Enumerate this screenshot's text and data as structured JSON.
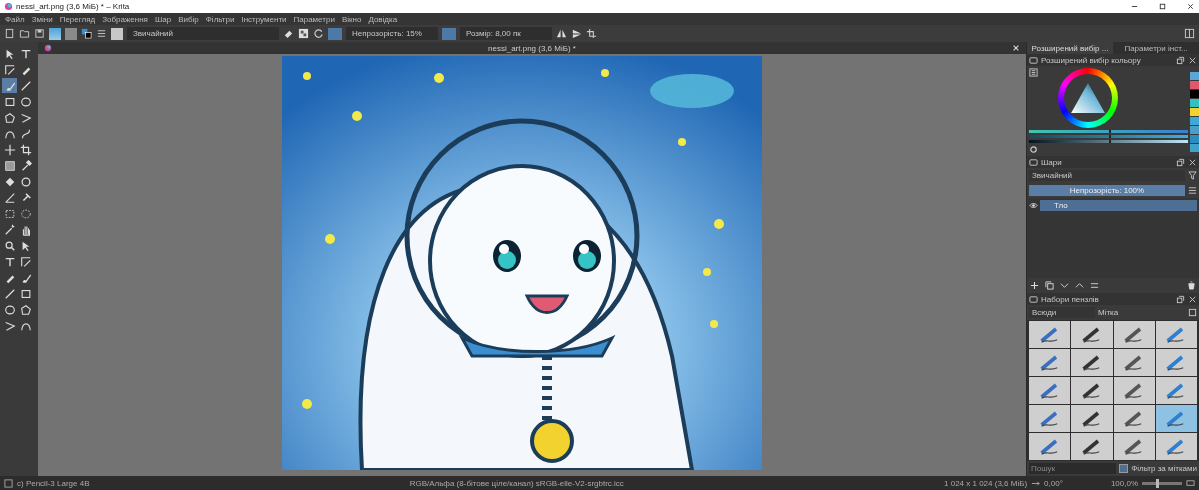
{
  "window": {
    "title": "nessi_art.png (3,6 МіБ) * – Krita"
  },
  "menu": [
    "Файл",
    "Зміни",
    "Перегляд",
    "Зображення",
    "Шар",
    "Вибір",
    "Фільтри",
    "Інструменти",
    "Параметри",
    "Вікно",
    "Довідка"
  ],
  "toolbar": {
    "blend_mode": "Звичайний",
    "opacity": "Непрозорість: 15%",
    "size": "Розмір: 8,00 пк"
  },
  "tools": [
    {
      "selected": false
    },
    {
      "selected": false
    },
    {
      "selected": false
    },
    {
      "selected": false
    },
    {
      "selected": true
    },
    {
      "selected": false
    },
    {
      "selected": false
    },
    {
      "selected": false
    },
    {
      "selected": false
    },
    {
      "selected": false
    },
    {
      "selected": false
    },
    {
      "selected": false
    },
    {
      "selected": false
    },
    {
      "selected": false
    },
    {
      "selected": false
    },
    {
      "selected": false
    },
    {
      "selected": false
    },
    {
      "selected": false
    },
    {
      "selected": false
    },
    {
      "selected": false
    },
    {
      "selected": false
    },
    {
      "selected": false
    },
    {
      "selected": false
    },
    {
      "selected": false
    },
    {
      "selected": false
    },
    {
      "selected": false
    },
    {
      "selected": false
    },
    {
      "selected": false
    },
    {
      "selected": false
    },
    {
      "selected": false
    },
    {
      "selected": false
    },
    {
      "selected": false
    },
    {
      "selected": false
    },
    {
      "selected": false
    },
    {
      "selected": false
    },
    {
      "selected": false
    }
  ],
  "document_tab": {
    "title": "nessi_art.png (3,6 МіБ) *"
  },
  "dock_tabs": [
    {
      "label": "Розширений вибір ...",
      "selected": true
    },
    {
      "label": "Параметри інст...",
      "selected": false
    }
  ],
  "color_selector": {
    "title": "Розширений вибір кольору",
    "sliders": [
      {
        "level": 0.5
      },
      {
        "level": 0.5
      },
      {
        "level": 0.5
      }
    ],
    "swatches": [
      {
        "color": "#5aa6d6"
      },
      {
        "color": "#e0596b"
      },
      {
        "color": "#000000"
      },
      {
        "color": "#2fc2c0"
      },
      {
        "color": "#f3d130"
      },
      {
        "color": "#3ea9d9"
      },
      {
        "color": "#4d9ec7"
      },
      {
        "color": "#2b8cbf"
      },
      {
        "color": "#3fa2cb"
      }
    ]
  },
  "layers": {
    "title": "Шари",
    "blend_mode": "Звичайний",
    "opacity": {
      "label": "Непрозорість: 100%",
      "level": 1
    },
    "items": [
      {
        "name": "Тло",
        "visible": true,
        "selected": true
      }
    ]
  },
  "brush_presets": {
    "title": "Набори пензлів",
    "filter": "Всюди",
    "tag": "Мітка",
    "search": {
      "placeholder": "Пошук"
    },
    "filter_by_tag": {
      "label": "Фільтр за мітками",
      "checked": true
    },
    "items": [
      {
        "selected": false
      },
      {
        "selected": false
      },
      {
        "selected": false
      },
      {
        "selected": false
      },
      {
        "selected": false
      },
      {
        "selected": false
      },
      {
        "selected": false
      },
      {
        "selected": false
      },
      {
        "selected": false
      },
      {
        "selected": false
      },
      {
        "selected": false
      },
      {
        "selected": false
      },
      {
        "selected": false
      },
      {
        "selected": false
      },
      {
        "selected": false
      },
      {
        "selected": true
      },
      {
        "selected": false
      },
      {
        "selected": false
      },
      {
        "selected": false
      },
      {
        "selected": false
      }
    ]
  },
  "status_bar": {
    "brush": "c) Pencil-3 Large 4B",
    "color_space": "RGB/Альфа (8-бітове ціле/канал)  sRGB-elle-V2-srgbtrc.icc",
    "image_size": "1 024 x 1 024 (3,6 МіБ)",
    "rotation": "0,00°",
    "zoom": "100,0%",
    "zoom_slider": {
      "level": 0.35
    }
  }
}
